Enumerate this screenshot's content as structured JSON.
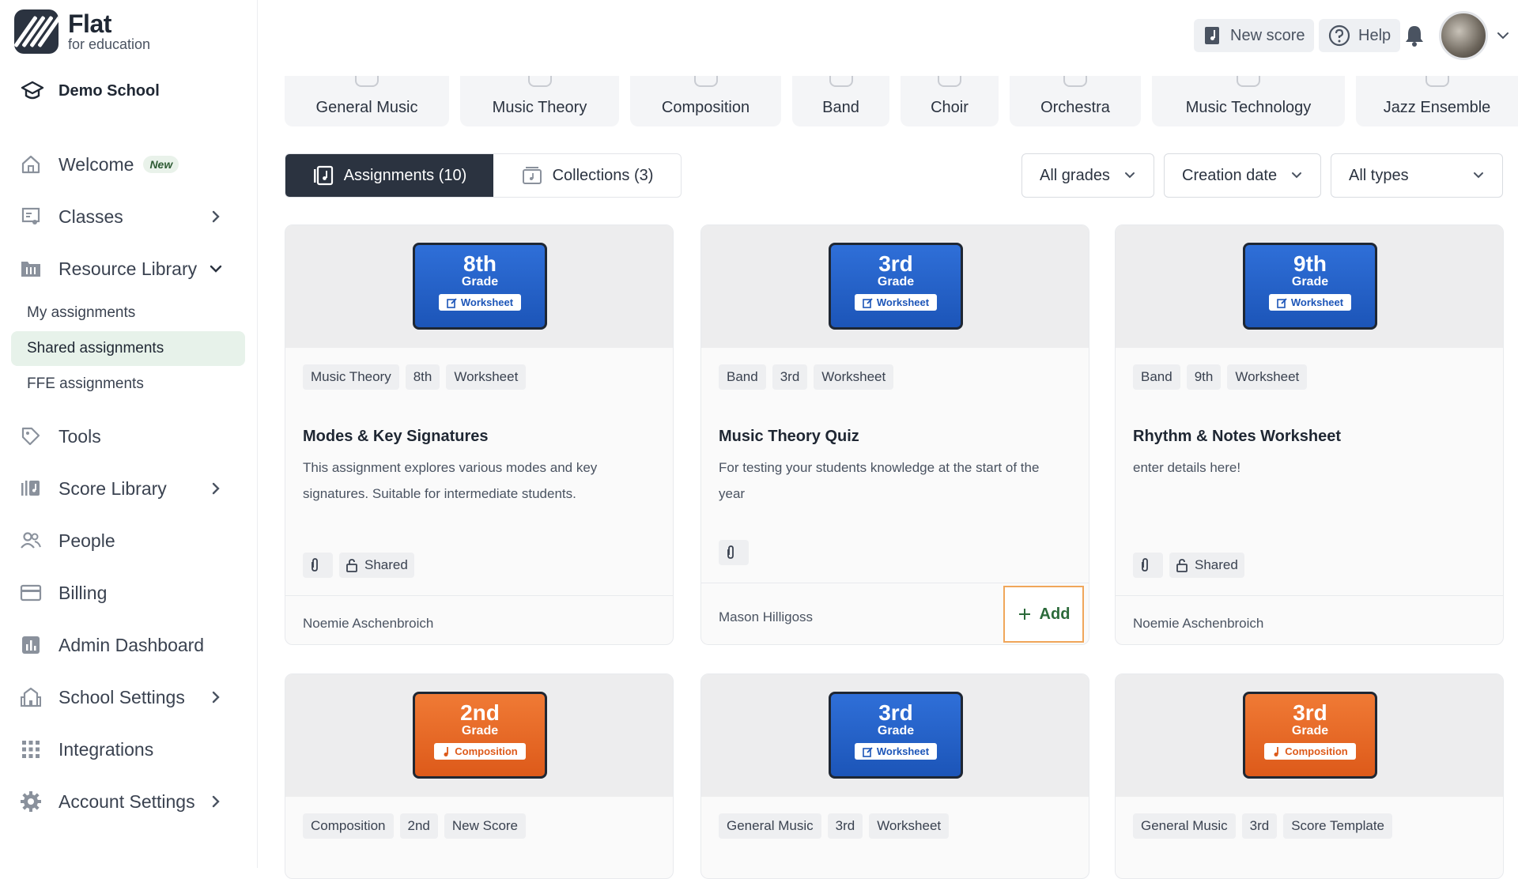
{
  "brand": {
    "title": "Flat",
    "subtitle": "for education"
  },
  "school": {
    "name": "Demo School"
  },
  "sidebar": {
    "welcome": {
      "label": "Welcome",
      "badge": "New"
    },
    "classes": "Classes",
    "resource_library": "Resource Library",
    "sub": [
      "My assignments",
      "Shared assignments",
      "FFE assignments"
    ],
    "tools": "Tools",
    "score_library": "Score Library",
    "people": "People",
    "billing": "Billing",
    "admin_dashboard": "Admin Dashboard",
    "school_settings": "School Settings",
    "integrations": "Integrations",
    "account_settings": "Account Settings"
  },
  "header": {
    "new_score": "New score",
    "help": "Help"
  },
  "categories": [
    "General Music",
    "Music Theory",
    "Composition",
    "Band",
    "Choir",
    "Orchestra",
    "Music Technology",
    "Jazz Ensemble"
  ],
  "toggle": {
    "assignments": "Assignments (10)",
    "collections": "Collections (3)"
  },
  "filters": {
    "grades": "All grades",
    "sort": "Creation date",
    "types": "All types"
  },
  "cards": [
    {
      "grade": "8th",
      "grade_word": "Grade",
      "kind": "Worksheet",
      "chips": [
        "Music Theory",
        "8th",
        "Worksheet"
      ],
      "title": "Modes & Key Signatures",
      "desc": "This assignment explores various modes and key signatures. Suitable for intermediate students.",
      "shared": "Shared",
      "author": "Noemie Aschenbroich"
    },
    {
      "grade": "3rd",
      "grade_word": "Grade",
      "kind": "Worksheet",
      "chips": [
        "Band",
        "3rd",
        "Worksheet"
      ],
      "title": "Music Theory Quiz",
      "desc": "For testing your students knowledge at the start of the year",
      "author": "Mason Hilligoss",
      "add": "Add"
    },
    {
      "grade": "9th",
      "grade_word": "Grade",
      "kind": "Worksheet",
      "chips": [
        "Band",
        "9th",
        "Worksheet"
      ],
      "title": "Rhythm & Notes Worksheet",
      "desc": "enter details here!",
      "shared": "Shared",
      "author": "Noemie Aschenbroich"
    },
    {
      "grade": "2nd",
      "grade_word": "Grade",
      "kind": "Composition",
      "chips": [
        "Composition",
        "2nd",
        "New Score"
      ]
    },
    {
      "grade": "3rd",
      "grade_word": "Grade",
      "kind": "Worksheet",
      "chips": [
        "General Music",
        "3rd",
        "Worksheet"
      ]
    },
    {
      "grade": "3rd",
      "grade_word": "Grade",
      "kind": "Composition",
      "chips": [
        "General Music",
        "3rd",
        "Score Template"
      ]
    }
  ],
  "colors": {
    "sidebar_active": "#e7f2ea",
    "toggle_active": "#2b3340",
    "worksheet_blue": "#1c55b8",
    "composition_orange": "#dd5a1a",
    "add_highlight": "#f0a65a"
  }
}
